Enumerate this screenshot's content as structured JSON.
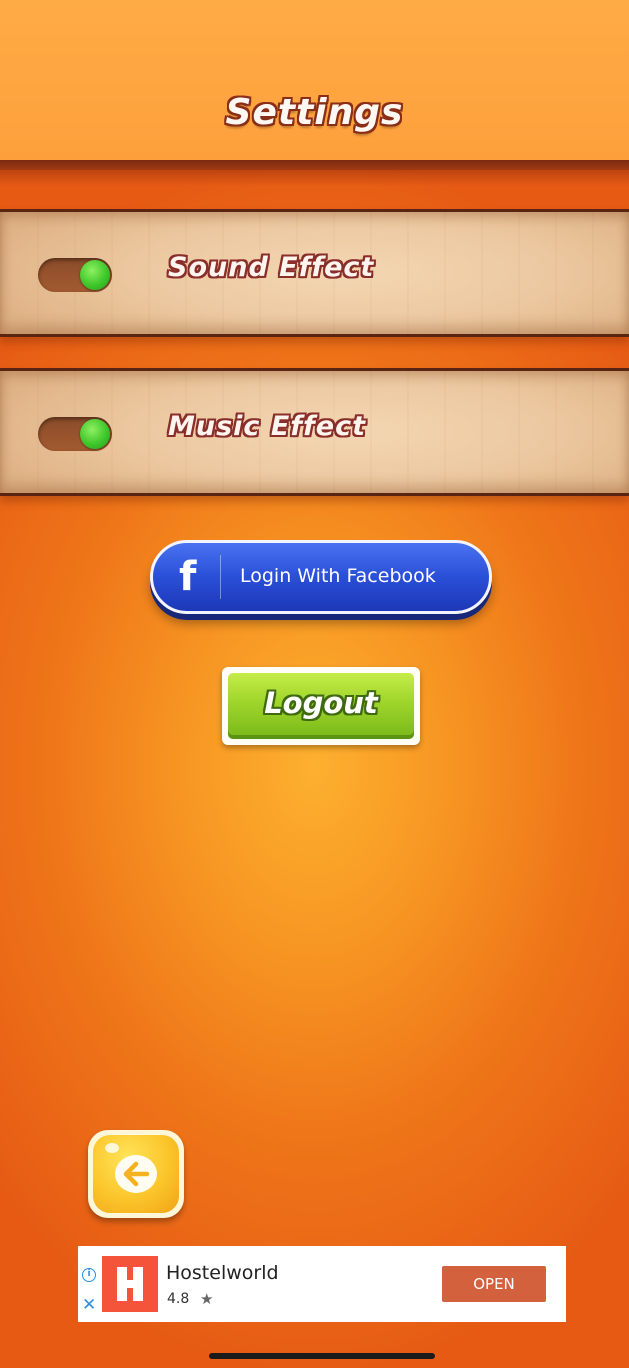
{
  "header": {
    "title": "Settings"
  },
  "settings": {
    "sound_effect": {
      "label": "Sound Effect",
      "enabled": true
    },
    "music_effect": {
      "label": "Music Effect",
      "enabled": true
    }
  },
  "buttons": {
    "facebook_icon": "f",
    "facebook_login_label": "Login With Facebook",
    "logout_label": "Logout",
    "back_icon": "arrow-left-icon"
  },
  "ad": {
    "app_name": "Hostelworld",
    "rating": "4.8",
    "star": "★",
    "info_glyph": "i",
    "close_glyph": "✕",
    "open_label": "OPEN"
  },
  "colors": {
    "background_center": "#fdb02f",
    "background_edge": "#e65a14",
    "header": "#fda03c",
    "toggle_on": "#3fc72b",
    "facebook_blue": "#2a4fd8",
    "logout_green": "#9fd52a",
    "back_yellow": "#fbc52a",
    "ad_open": "#d4613d"
  }
}
